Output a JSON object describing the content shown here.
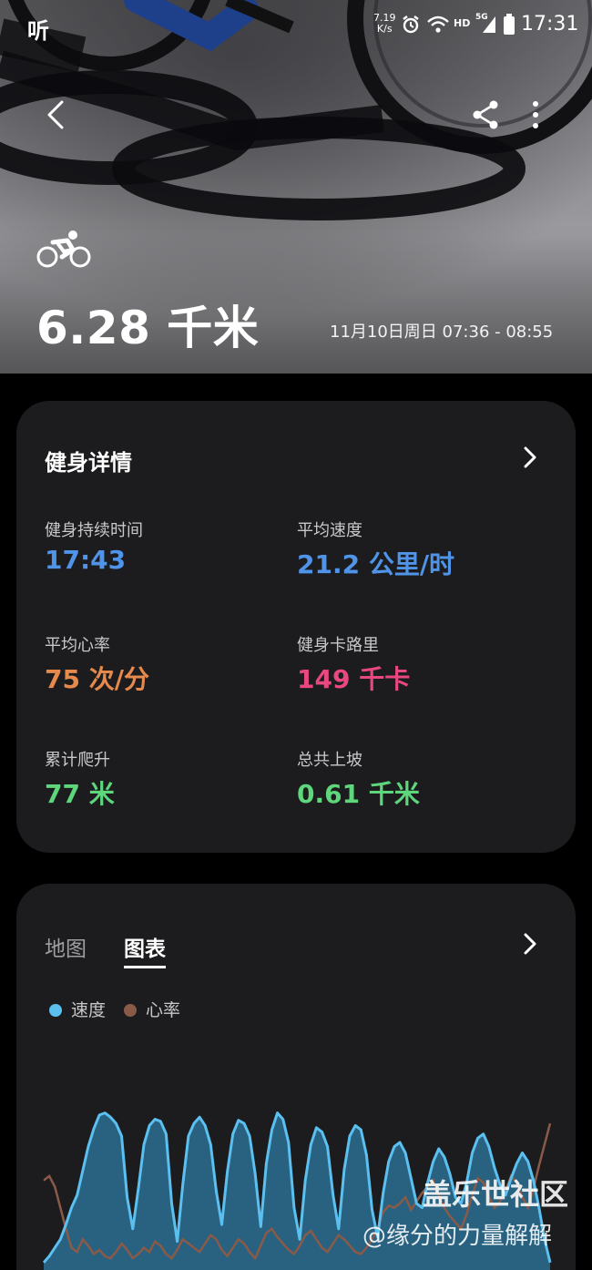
{
  "status_bar": {
    "app_glyph": "听",
    "net_speed_value": "7.19",
    "net_speed_unit": "K/s",
    "hd_label": "HD",
    "network_label": "5G",
    "time": "17:31",
    "icons": [
      "alarm-icon",
      "wifi-icon",
      "signal-icon",
      "battery-icon"
    ]
  },
  "header": {
    "icons": [
      "back-icon",
      "share-icon",
      "more-icon",
      "cycling-icon"
    ],
    "distance": "6.28 千米",
    "date_range": "11月10日周日 07:36 - 08:55"
  },
  "details": {
    "title": "健身详情",
    "metrics": [
      {
        "label": "健身持续时间",
        "value": "17:43",
        "color": "#4f94e8"
      },
      {
        "label": "平均速度",
        "value": "21.2 公里/时",
        "color": "#4f94e8"
      },
      {
        "label": "平均心率",
        "value": "75 次/分",
        "color": "#e6894d"
      },
      {
        "label": "健身卡路里",
        "value": "149 千卡",
        "color": "#e8487f"
      },
      {
        "label": "累计爬升",
        "value": "77 米",
        "color": "#5ed67c"
      },
      {
        "label": "总共上坡",
        "value": "0.61 千米",
        "color": "#5ed67c"
      }
    ]
  },
  "chart_card": {
    "tabs": [
      {
        "label": "地图",
        "active": false
      },
      {
        "label": "图表",
        "active": true
      }
    ],
    "legend": [
      {
        "label": "速度",
        "color": "#5bc0f0"
      },
      {
        "label": "心率",
        "color": "#8a5a48"
      }
    ]
  },
  "chart_data": {
    "type": "area",
    "title": "",
    "xlabel": "",
    "ylabel": "",
    "series": [
      {
        "name": "速度",
        "color": "#5bc0f0",
        "values": [
          8,
          14,
          22,
          30,
          44,
          60,
          72,
          95,
          118,
          135,
          148,
          150,
          146,
          140,
          128,
          70,
          40,
          78,
          120,
          138,
          144,
          142,
          130,
          64,
          28,
          82,
          128,
          140,
          146,
          138,
          120,
          76,
          44,
          94,
          130,
          143,
          140,
          128,
          92,
          42,
          102,
          134,
          150,
          144,
          122,
          60,
          30,
          86,
          120,
          136,
          132,
          118,
          72,
          40,
          96,
          128,
          138,
          134,
          110,
          58,
          32,
          74,
          104,
          118,
          122,
          112,
          88,
          64,
          60,
          84,
          104,
          116,
          108,
          92,
          70,
          64,
          84,
          112,
          126,
          130,
          118,
          98,
          82,
          72,
          88,
          102,
          112,
          104,
          86,
          60,
          30,
          8
        ]
      },
      {
        "name": "心率",
        "color": "#8a5a48",
        "values": [
          86,
          90,
          80,
          60,
          40,
          22,
          18,
          30,
          24,
          16,
          20,
          14,
          12,
          18,
          26,
          20,
          12,
          16,
          22,
          18,
          28,
          24,
          16,
          12,
          20,
          30,
          26,
          22,
          18,
          26,
          34,
          30,
          20,
          14,
          22,
          30,
          26,
          18,
          12,
          24,
          36,
          40,
          32,
          26,
          20,
          16,
          24,
          34,
          38,
          30,
          22,
          18,
          26,
          34,
          30,
          24,
          18,
          16,
          22,
          30,
          40,
          56,
          62,
          60,
          64,
          70,
          58,
          66,
          74,
          80,
          86,
          72,
          60,
          52,
          46,
          40,
          54,
          72,
          88,
          84,
          70,
          60,
          66,
          76,
          90,
          84,
          70,
          60,
          78,
          100,
          120,
          140
        ]
      }
    ]
  },
  "watermark": {
    "line1": "盖乐世社区",
    "line2": "@缘分的力量解解"
  }
}
